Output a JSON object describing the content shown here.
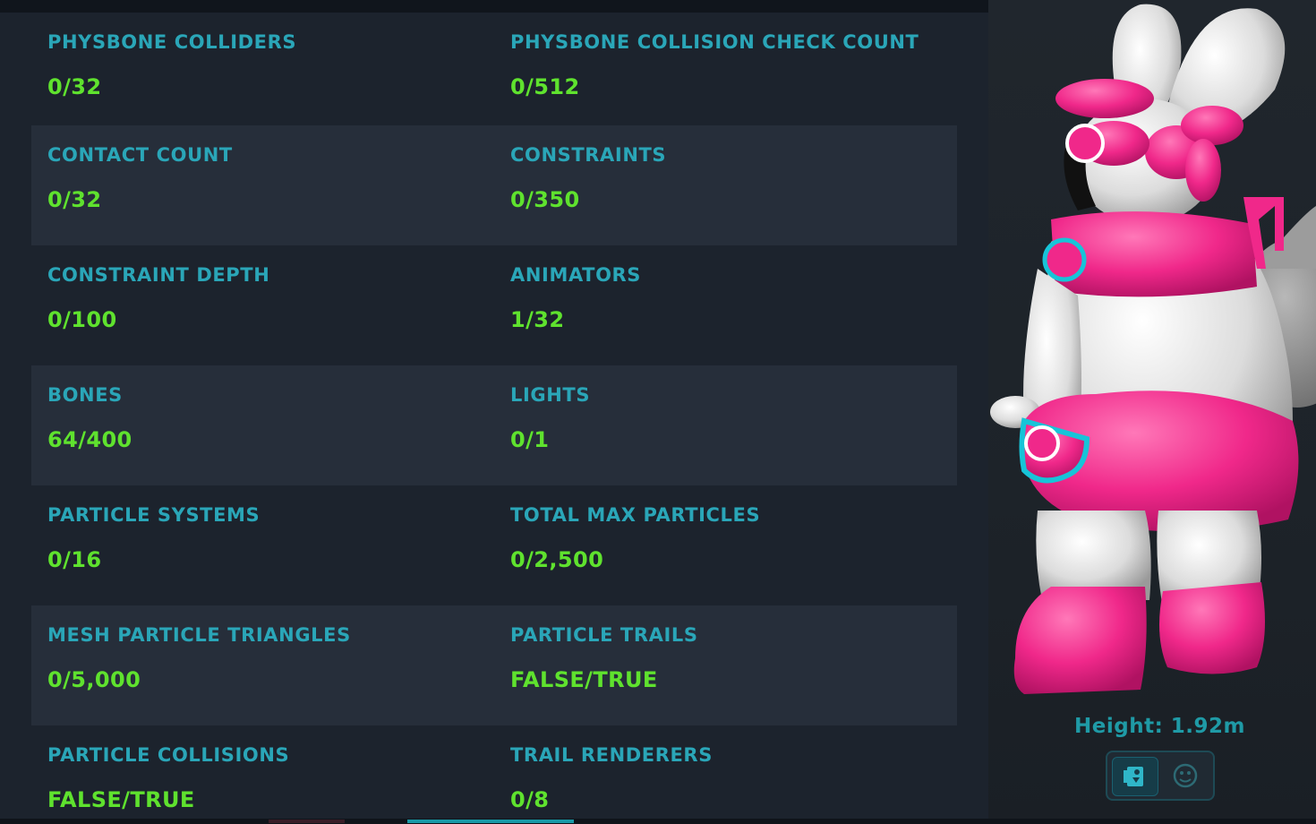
{
  "stats": [
    {
      "left": {
        "label": "PHYSBONE COLLIDERS",
        "value": "0/32"
      },
      "right": {
        "label": "PHYSBONE COLLISION CHECK COUNT",
        "value": "0/512"
      }
    },
    {
      "left": {
        "label": "CONTACT COUNT",
        "value": "0/32"
      },
      "right": {
        "label": "CONSTRAINTS",
        "value": "0/350"
      }
    },
    {
      "left": {
        "label": "CONSTRAINT DEPTH",
        "value": "0/100"
      },
      "right": {
        "label": "ANIMATORS",
        "value": "1/32"
      }
    },
    {
      "left": {
        "label": "BONES",
        "value": "64/400"
      },
      "right": {
        "label": "LIGHTS",
        "value": "0/1"
      }
    },
    {
      "left": {
        "label": "PARTICLE SYSTEMS",
        "value": "0/16"
      },
      "right": {
        "label": "TOTAL MAX PARTICLES",
        "value": "0/2,500"
      }
    },
    {
      "left": {
        "label": "MESH PARTICLE TRIANGLES",
        "value": "0/5,000"
      },
      "right": {
        "label": "PARTICLE TRAILS",
        "value": "FALSE/TRUE"
      }
    },
    {
      "left": {
        "label": "PARTICLE COLLISIONS",
        "value": "FALSE/TRUE"
      },
      "right": {
        "label": "TRAIL RENDERERS",
        "value": "0/8"
      }
    }
  ],
  "preview": {
    "height_text": "Height: 1.92m",
    "view_toggle": [
      {
        "icon": "avatar-body-icon",
        "active": true
      },
      {
        "icon": "avatar-face-icon",
        "active": false
      }
    ]
  },
  "colors": {
    "label": "#2aa6b8",
    "value": "#5fe22e",
    "panel_bg": "#1c232d",
    "row_shaded": "#262e3a",
    "avatar_pink": "#f0288a",
    "avatar_white": "#e6e6e6"
  }
}
